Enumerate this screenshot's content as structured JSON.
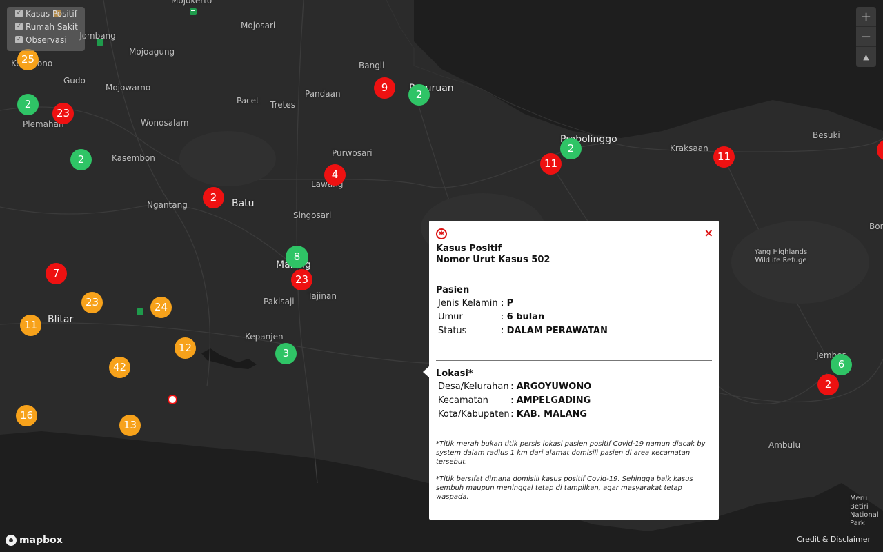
{
  "colors": {
    "red": "#ee1111",
    "green": "#2fc466",
    "orange": "#f7a21b",
    "background": "#2b2b2b",
    "sea": "#1e1e1e"
  },
  "legend": {
    "items": [
      {
        "label": "Kasus Positif",
        "icon": "checkbox-checked-icon",
        "checked": true
      },
      {
        "label": "Rumah Sakit",
        "icon": "checkbox-checked-icon",
        "checked": true
      },
      {
        "label": "Observasi",
        "icon": "checkbox-checked-icon",
        "checked": true
      }
    ]
  },
  "zoom": {
    "in": "+",
    "out": "−",
    "compass": "▲"
  },
  "places": [
    "Mojokerto",
    "Mojosari",
    "Jombang",
    "Mojoagung",
    "Kertosono",
    "Gudo",
    "Mojowarno",
    "Plemahan",
    "Wonosalam",
    "Kasembon",
    "Ngantang",
    "Pacet",
    "Tretes",
    "Pandaan",
    "Bangil",
    "Pasuruan",
    "Purwosari",
    "Lawang",
    "Batu",
    "Singosari",
    "Malang",
    "Pakisaji",
    "Tajinan",
    "Kepanjen",
    "Blitar",
    "Probolinggo",
    "Kraksaan",
    "Besuki",
    "Yang Highlands Wildlife Refuge",
    "Jember",
    "Ambulu",
    "Meru Betiri National Park",
    "Bondowoso"
  ],
  "markers": [
    {
      "value": "25",
      "color": "orange"
    },
    {
      "value": "2",
      "color": "green"
    },
    {
      "value": "23",
      "color": "red"
    },
    {
      "value": "2",
      "color": "green"
    },
    {
      "value": "2",
      "color": "red"
    },
    {
      "value": "4",
      "color": "red"
    },
    {
      "value": "9",
      "color": "red"
    },
    {
      "value": "2",
      "color": "green"
    },
    {
      "value": "2",
      "color": "green"
    },
    {
      "value": "11",
      "color": "red"
    },
    {
      "value": "11",
      "color": "red"
    },
    {
      "value": "8",
      "color": "green"
    },
    {
      "value": "23",
      "color": "red"
    },
    {
      "value": "7",
      "color": "red"
    },
    {
      "value": "23",
      "color": "orange"
    },
    {
      "value": "24",
      "color": "orange"
    },
    {
      "value": "11",
      "color": "orange"
    },
    {
      "value": "12",
      "color": "orange"
    },
    {
      "value": "3",
      "color": "green"
    },
    {
      "value": "42",
      "color": "orange"
    },
    {
      "value": "16",
      "color": "orange"
    },
    {
      "value": "13",
      "color": "orange"
    },
    {
      "value": "6",
      "color": "green"
    },
    {
      "value": "2",
      "color": "red"
    }
  ],
  "popup": {
    "icon": "virus-icon",
    "title": "Kasus Positif",
    "subtitle": "Nomor Urut Kasus 502",
    "close": "×",
    "pasien": {
      "heading": "Pasien",
      "rows": [
        {
          "key": "Jenis Kelamin",
          "value": "P"
        },
        {
          "key": "Umur",
          "value": "6 bulan"
        },
        {
          "key": "Status",
          "value": "DALAM PERAWATAN"
        }
      ]
    },
    "lokasi": {
      "heading": "Lokasi*",
      "rows": [
        {
          "key": "Desa/Kelurahan",
          "value": "ARGOYUWONO"
        },
        {
          "key": "Kecamatan",
          "value": "AMPELGADING"
        },
        {
          "key": "Kota/Kabupaten",
          "value": "KAB. MALANG"
        }
      ]
    },
    "notes": [
      "*Titik merah bukan titik persis lokasi pasien positif Covid-19 namun diacak by system dalam radius 1 km dari alamat domisili pasien di area kecamatan tersebut.",
      "*Titik bersifat dimana domisili kasus positif Covid-19. Sehingga baik kasus sembuh maupun meninggal tetap di tampilkan, agar masyarakat tetap waspada."
    ]
  },
  "footer": {
    "credit": "Credit & Disclaimer",
    "logo": "mapbox"
  }
}
